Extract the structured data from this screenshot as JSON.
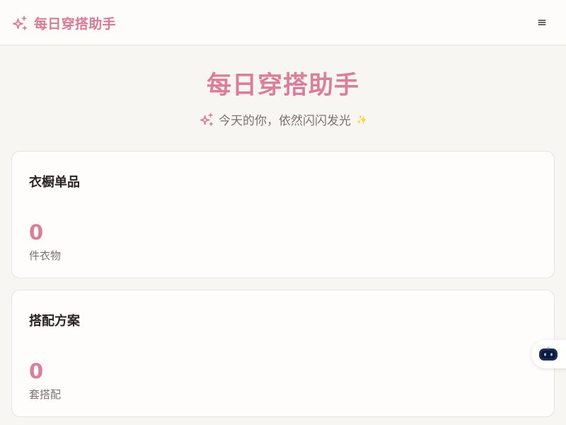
{
  "header": {
    "brand_icon": "sparkles-icon",
    "brand_title": "每日穿搭助手",
    "menu_icon": "menu-icon",
    "menu_glyph": "≡"
  },
  "hero": {
    "title": "每日穿搭助手",
    "subtitle": "今天的你，依然闪闪发光",
    "lead_icon": "sparkles-icon",
    "trail_icon": "small-sparkle-icon",
    "trail_glyph": "✨"
  },
  "stats": [
    {
      "title": "衣橱单品",
      "value": "0",
      "unit": "件衣物"
    },
    {
      "title": "搭配方案",
      "value": "0",
      "unit": "套搭配"
    }
  ],
  "assistant": {
    "icon": "robot-icon"
  },
  "colors": {
    "accent": "#dc7d9a",
    "background": "#f8f6f3",
    "card": "#fefdfc",
    "border": "#e8e3df",
    "muted_text": "#7b736f"
  }
}
